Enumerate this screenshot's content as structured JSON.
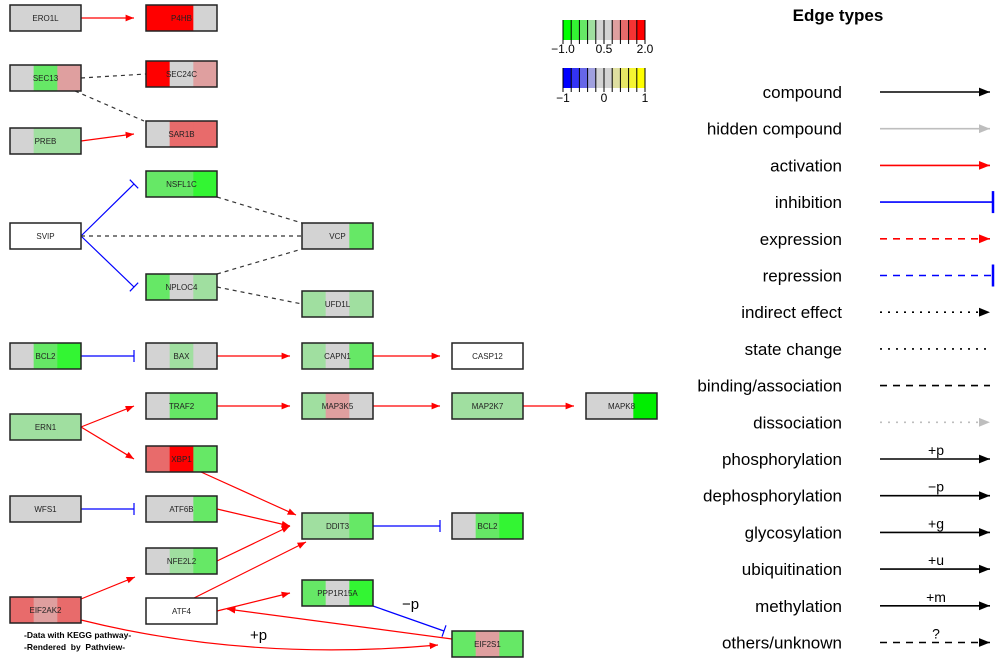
{
  "colors": {
    "gray": "#d3d3d3",
    "red": "#ff0000",
    "r1": "#df9f9f",
    "r2": "#e86b6b",
    "g1": "#a0dfa0",
    "g2": "#66e866",
    "g3": "#33f533",
    "g4": "#00ee00",
    "white": "#ffffff"
  },
  "nodes": [
    {
      "id": "ERO1L",
      "label": "ERO1L",
      "fill": [
        "gray",
        "gray",
        "gray"
      ]
    },
    {
      "id": "P4HB",
      "label": "P4HB",
      "fill": [
        "red",
        "red",
        "gray"
      ]
    },
    {
      "id": "SEC13",
      "label": "SEC13",
      "fill": [
        "gray",
        "g2",
        "r1"
      ]
    },
    {
      "id": "SEC24C",
      "label": "SEC24C",
      "fill": [
        "red",
        "gray",
        "r1"
      ]
    },
    {
      "id": "SAR1B",
      "label": "SAR1B",
      "fill": [
        "gray",
        "r2",
        "r2"
      ]
    },
    {
      "id": "PREB",
      "label": "PREB",
      "fill": [
        "gray",
        "g1",
        "g1"
      ]
    },
    {
      "id": "NSFL1C",
      "label": "NSFL1C",
      "fill": [
        "g2",
        "g2",
        "g3"
      ]
    },
    {
      "id": "SVIP",
      "label": "SVIP",
      "fill": [
        "white",
        "white",
        "white"
      ]
    },
    {
      "id": "VCP",
      "label": "VCP",
      "fill": [
        "gray",
        "gray",
        "g2"
      ]
    },
    {
      "id": "NPLOC4",
      "label": "NPLOC4",
      "fill": [
        "g2",
        "gray",
        "g1"
      ]
    },
    {
      "id": "UFD1L",
      "label": "UFD1L",
      "fill": [
        "g1",
        "gray",
        "g1"
      ]
    },
    {
      "id": "BCL2a",
      "label": "BCL2",
      "fill": [
        "gray",
        "g2",
        "g3"
      ]
    },
    {
      "id": "BAX",
      "label": "BAX",
      "fill": [
        "gray",
        "g1",
        "gray"
      ]
    },
    {
      "id": "CAPN1",
      "label": "CAPN1",
      "fill": [
        "g1",
        "gray",
        "g2"
      ]
    },
    {
      "id": "CASP12",
      "label": "CASP12",
      "fill": [
        "white",
        "white",
        "white"
      ]
    },
    {
      "id": "TRAF2",
      "label": "TRAF2",
      "fill": [
        "gray",
        "g2",
        "g2"
      ]
    },
    {
      "id": "MAP3K5",
      "label": "MAP3K5",
      "fill": [
        "g1",
        "r1",
        "gray"
      ]
    },
    {
      "id": "MAP2K7",
      "label": "MAP2K7",
      "fill": [
        "g1",
        "g1",
        "g1"
      ]
    },
    {
      "id": "MAPK8",
      "label": "MAPK8",
      "fill": [
        "gray",
        "gray",
        "g4"
      ]
    },
    {
      "id": "ERN1",
      "label": "ERN1",
      "fill": [
        "g1",
        "g1",
        "g1"
      ]
    },
    {
      "id": "XBP1",
      "label": "XBP1",
      "fill": [
        "r2",
        "red",
        "g2"
      ]
    },
    {
      "id": "WFS1",
      "label": "WFS1",
      "fill": [
        "gray",
        "gray",
        "gray"
      ]
    },
    {
      "id": "ATF6B",
      "label": "ATF6B",
      "fill": [
        "gray",
        "gray",
        "g2"
      ]
    },
    {
      "id": "DDIT3",
      "label": "DDIT3",
      "fill": [
        "g1",
        "g1",
        "g2"
      ]
    },
    {
      "id": "BCL2b",
      "label": "BCL2",
      "fill": [
        "gray",
        "g2",
        "g3"
      ]
    },
    {
      "id": "NFE2L2",
      "label": "NFE2L2",
      "fill": [
        "gray",
        "g1",
        "g2"
      ]
    },
    {
      "id": "EIF2AK2",
      "label": "EIF2AK2",
      "fill": [
        "r2",
        "r1",
        "r2"
      ]
    },
    {
      "id": "ATF4",
      "label": "ATF4",
      "fill": [
        "white",
        "white",
        "white"
      ]
    },
    {
      "id": "PPP1R15A",
      "label": "PPP1R15A",
      "fill": [
        "g2",
        "gray",
        "g3"
      ]
    },
    {
      "id": "EIF2S1",
      "label": "EIF2S1",
      "fill": [
        "g2",
        "r1",
        "g2"
      ]
    }
  ],
  "edges": [
    {
      "from": "ERO1L",
      "to": "P4HB",
      "type": "activation"
    },
    {
      "from": "SEC13",
      "to": "SEC24C",
      "type": "binding"
    },
    {
      "from": "SEC13",
      "to": "SAR1B",
      "type": "binding"
    },
    {
      "from": "PREB",
      "to": "SAR1B",
      "type": "activation"
    },
    {
      "from": "SVIP",
      "to": "NSFL1C",
      "type": "inhibition"
    },
    {
      "from": "SVIP",
      "to": "NPLOC4",
      "type": "inhibition"
    },
    {
      "from": "SVIP",
      "to": "VCP",
      "type": "binding"
    },
    {
      "from": "NSFL1C",
      "to": "VCP",
      "type": "binding"
    },
    {
      "from": "NPLOC4",
      "to": "VCP",
      "type": "binding"
    },
    {
      "from": "NPLOC4",
      "to": "UFD1L",
      "type": "binding"
    },
    {
      "from": "BCL2a",
      "to": "BAX",
      "type": "inhibition"
    },
    {
      "from": "BAX",
      "to": "CAPN1",
      "type": "activation"
    },
    {
      "from": "CAPN1",
      "to": "CASP12",
      "type": "activation"
    },
    {
      "from": "TRAF2",
      "to": "MAP3K5",
      "type": "activation"
    },
    {
      "from": "MAP3K5",
      "to": "MAP2K7",
      "type": "activation"
    },
    {
      "from": "MAP2K7",
      "to": "MAPK8",
      "type": "activation"
    },
    {
      "from": "ERN1",
      "to": "TRAF2",
      "type": "activation"
    },
    {
      "from": "ERN1",
      "to": "XBP1",
      "type": "activation"
    },
    {
      "from": "XBP1",
      "to": "DDIT3",
      "type": "activation"
    },
    {
      "from": "WFS1",
      "to": "ATF6B",
      "type": "inhibition"
    },
    {
      "from": "ATF6B",
      "to": "DDIT3",
      "type": "activation"
    },
    {
      "from": "NFE2L2",
      "to": "DDIT3",
      "type": "activation"
    },
    {
      "from": "ATF4",
      "to": "DDIT3",
      "type": "activation"
    },
    {
      "from": "DDIT3",
      "to": "BCL2b",
      "type": "inhibition"
    },
    {
      "from": "EIF2AK2",
      "to": "NFE2L2",
      "type": "activation"
    },
    {
      "from": "ATF4",
      "to": "PPP1R15A",
      "type": "activation"
    },
    {
      "from": "PPP1R15A",
      "to": "EIF2S1",
      "type": "inhibition"
    },
    {
      "from": "EIF2S1",
      "to": "ATF4",
      "type": "activation"
    },
    {
      "from": "EIF2AK2",
      "to": "EIF2S1",
      "type": "activation"
    }
  ],
  "edge_labels": {
    "minus_p": "−p",
    "plus_p": "+p"
  },
  "footer": {
    "line1": "-Data with KEGG pathway-",
    "line2": "-Rendered  by  Pathview-"
  },
  "color_key": {
    "gene": {
      "ticks": [
        "−1.0",
        "0.5",
        "2.0"
      ],
      "colors": [
        "#00ff00",
        "#33f533",
        "#66e866",
        "#a0dfa0",
        "#d3d3d3",
        "#d3d3d3",
        "#df9f9f",
        "#e86b6b",
        "#f53333",
        "#ff0000"
      ]
    },
    "cpd": {
      "ticks": [
        "−1",
        "0",
        "1"
      ],
      "colors": [
        "#0000ff",
        "#3333f5",
        "#6666e8",
        "#a0a0df",
        "#d3d3d3",
        "#d3d3d3",
        "#dfdfa0",
        "#e8e866",
        "#f5f533",
        "#ffff00"
      ]
    }
  },
  "legend": {
    "title": "Edge types",
    "items": [
      {
        "label": "compound",
        "color": "#000000",
        "dash": "",
        "head": "arrow",
        "tag": ""
      },
      {
        "label": "hidden compound",
        "color": "#bebebe",
        "dash": "",
        "head": "arrow",
        "tag": ""
      },
      {
        "label": "activation",
        "color": "#ff0000",
        "dash": "",
        "head": "arrow",
        "tag": ""
      },
      {
        "label": "inhibition",
        "color": "#0000ff",
        "dash": "",
        "head": "bar",
        "tag": ""
      },
      {
        "label": "expression",
        "color": "#ff0000",
        "dash": "dashed",
        "head": "arrow",
        "tag": ""
      },
      {
        "label": "repression",
        "color": "#0000ff",
        "dash": "dashed",
        "head": "bar",
        "tag": ""
      },
      {
        "label": "indirect effect",
        "color": "#000000",
        "dash": "dotted",
        "head": "arrow",
        "tag": ""
      },
      {
        "label": "state change",
        "color": "#000000",
        "dash": "dotted",
        "head": "none",
        "tag": ""
      },
      {
        "label": "binding/association",
        "color": "#000000",
        "dash": "dashed",
        "head": "none",
        "tag": ""
      },
      {
        "label": "dissociation",
        "color": "#bebebe",
        "dash": "dotted",
        "head": "arrow",
        "tag": ""
      },
      {
        "label": "phosphorylation",
        "color": "#000000",
        "dash": "",
        "head": "arrow",
        "tag": "+p"
      },
      {
        "label": "dephosphorylation",
        "color": "#000000",
        "dash": "",
        "head": "arrow",
        "tag": "−p"
      },
      {
        "label": "glycosylation",
        "color": "#000000",
        "dash": "",
        "head": "arrow",
        "tag": "+g"
      },
      {
        "label": "ubiquitination",
        "color": "#000000",
        "dash": "",
        "head": "arrow",
        "tag": "+u"
      },
      {
        "label": "methylation",
        "color": "#000000",
        "dash": "",
        "head": "arrow",
        "tag": "+m"
      },
      {
        "label": "others/unknown",
        "color": "#000000",
        "dash": "dashed",
        "head": "arrow",
        "tag": "?"
      }
    ]
  }
}
